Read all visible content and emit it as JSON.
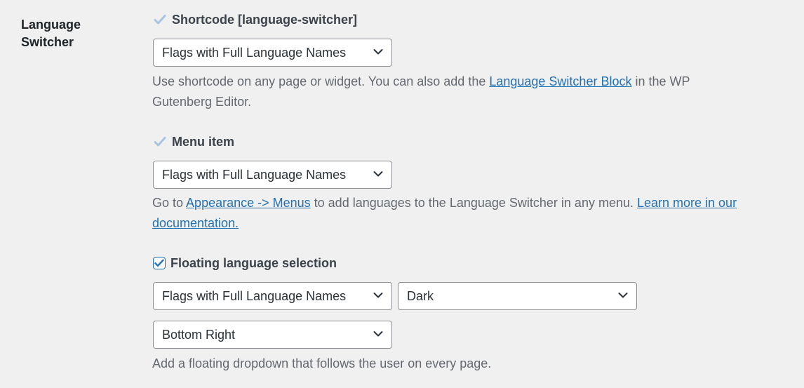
{
  "section": {
    "label": "Language Switcher"
  },
  "shortcode": {
    "checkbox_label": "Shortcode [language-switcher]",
    "checked": true,
    "disabled": true,
    "select_value": "Flags with Full Language Names",
    "desc_before": "Use shortcode on any page or widget. You can also add the ",
    "desc_link": "Language Switcher Block",
    "desc_after": " in the WP Gutenberg Editor."
  },
  "menu_item": {
    "checkbox_label": "Menu item",
    "checked": true,
    "disabled": true,
    "select_value": "Flags with Full Language Names",
    "desc_before": "Go to ",
    "desc_link1": "Appearance -> Menus",
    "desc_middle": " to add languages to the Language Switcher in any menu. ",
    "desc_link2": "Learn more in our documentation."
  },
  "floating": {
    "checkbox_label": "Floating language selection",
    "checked": true,
    "disabled": false,
    "select_style_value": "Flags with Full Language Names",
    "select_theme_value": "Dark",
    "select_position_value": "Bottom Right",
    "desc": "Add a floating dropdown that follows the user on every page."
  },
  "icons": {
    "checkmark": "checkmark-icon",
    "dropdown": "chevron-down-icon"
  },
  "colors": {
    "link": "#2271b1",
    "checkbox_border": "#2271b1",
    "disabled_check": "#a7c4e0"
  }
}
